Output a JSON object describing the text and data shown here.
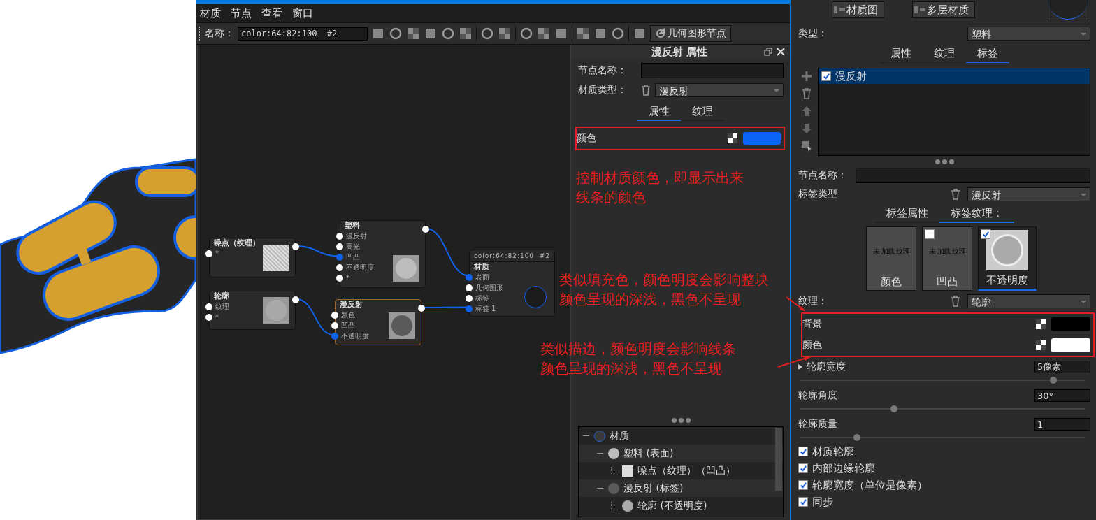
{
  "menu": [
    {
      "label": "材质"
    },
    {
      "label": "节点"
    },
    {
      "label": "查看"
    },
    {
      "label": "窗口"
    }
  ],
  "toolbar": {
    "name_label": "名称：",
    "name_value": "color:64:82:100  #2",
    "geometry_button": "几何图形节点"
  },
  "node_graph": {
    "nodes": [
      {
        "title": "噪点（纹理）",
        "selected": false,
        "ports": [
          {
            "label": "*",
            "connected": false
          }
        ]
      },
      {
        "title": "塑料",
        "selected": false,
        "ports": [
          {
            "label": "漫反射",
            "connected": false
          },
          {
            "label": "高光",
            "connected": false
          },
          {
            "label": "凹凸",
            "connected": true
          },
          {
            "label": "不透明度",
            "connected": false
          },
          {
            "label": "*",
            "connected": false
          }
        ]
      },
      {
        "title": "轮廓",
        "selected": false,
        "ports": [
          {
            "label": "纹理",
            "connected": false
          },
          {
            "label": "*",
            "connected": false
          }
        ]
      },
      {
        "title": "漫反射",
        "selected": true,
        "ports": [
          {
            "label": "颜色",
            "connected": false
          },
          {
            "label": "凹凸",
            "connected": false
          },
          {
            "label": "不透明度",
            "connected": true
          }
        ]
      },
      {
        "header": "color:64:82:100  #2",
        "title": "材质",
        "selected": false,
        "ports": [
          {
            "label": "表面",
            "connected": true
          },
          {
            "label": "几何图形",
            "connected": false
          },
          {
            "label": "标签",
            "connected": false
          },
          {
            "label": "标签 1",
            "connected": true
          }
        ]
      }
    ]
  },
  "properties": {
    "title": "漫反射 属性",
    "node_name_label": "节点名称：",
    "material_type_label": "材质类型：",
    "material_type_value": "漫反射",
    "tabs": [
      {
        "label": "属性",
        "selected": true
      },
      {
        "label": "纹理",
        "selected": false
      }
    ],
    "color_label": "颜色",
    "color": "#0a64f5",
    "tree": [
      {
        "label": "材质",
        "expanded": true,
        "children": [
          {
            "label": "塑料 (表面)",
            "expanded": true,
            "children": [
              {
                "label": "噪点（纹理）（凹凸）"
              }
            ]
          },
          {
            "label": "漫反射 (标签)",
            "expanded": true,
            "children": [
              {
                "label": "轮廓 (不透明度)"
              }
            ]
          }
        ]
      }
    ]
  },
  "right_panel": {
    "buttons": [
      "材质图",
      "多层材质"
    ],
    "type_label": "类型：",
    "type_value": "塑料",
    "tabs": [
      {
        "label": "属性",
        "selected": false
      },
      {
        "label": "纹理",
        "selected": false
      },
      {
        "label": "标签",
        "selected": true
      }
    ],
    "tag_list": [
      {
        "label": "漫反射",
        "checked": true,
        "selected": true
      }
    ],
    "node_name_label": "节点名称：",
    "tag_type_label": "标签类型",
    "tag_type_value": "漫反射",
    "tag_tabs": [
      {
        "label": "标签属性",
        "selected": false
      },
      {
        "label": "标签纹理：",
        "selected": true
      }
    ],
    "slots": [
      {
        "label": "颜色",
        "note": "未 加载 纹理",
        "selected": false
      },
      {
        "label": "凹凸",
        "note": "未 加载 纹理",
        "checked": false,
        "selected": false
      },
      {
        "label": "不透明度",
        "checked": true,
        "selected": true
      }
    ],
    "texture_label": "纹理：",
    "texture_value": "轮廓",
    "colors": [
      {
        "label": "背景",
        "color": "#000000"
      },
      {
        "label": "颜色",
        "color": "#ffffff"
      }
    ],
    "sliders": [
      {
        "label": "轮廓宽度",
        "value": "5像素",
        "level": 0.89,
        "expandable": true
      },
      {
        "label": "轮廓角度",
        "value": "30°",
        "level": 0.33,
        "expandable": false
      },
      {
        "label": "轮廓质量",
        "value": "1",
        "level": 0.2,
        "expandable": false
      }
    ],
    "checks": [
      {
        "label": "材质轮廓",
        "checked": true
      },
      {
        "label": "内部边缘轮廓",
        "checked": true
      },
      {
        "label": "轮廓宽度（单位是像素）",
        "checked": true
      },
      {
        "label": "同步",
        "checked": true
      }
    ]
  },
  "annotations": [
    {
      "lines": [
        "控制材质颜色，即显示出来",
        "线条的颜色"
      ]
    },
    {
      "lines": [
        "类似填充色，颜色明度会影响整块",
        "颜色呈现的深浅，黑色不呈现"
      ]
    },
    {
      "lines": [
        "类似描边，颜色明度会影响线条",
        "颜色呈现的深浅，黑色不呈现"
      ]
    }
  ]
}
